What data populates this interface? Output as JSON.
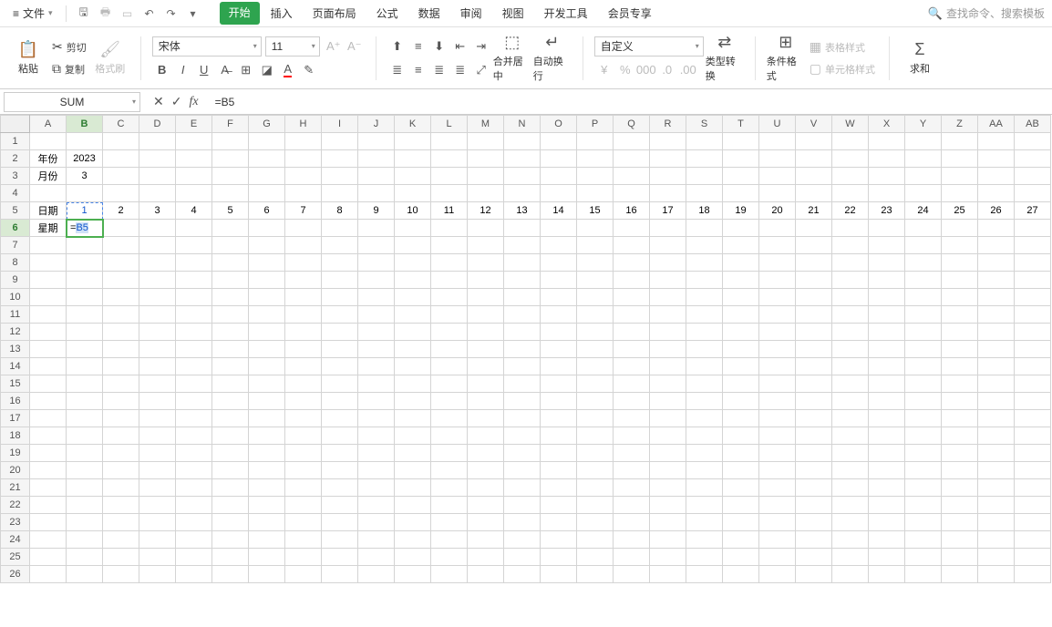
{
  "menubar": {
    "file_label": "文件",
    "tabs": [
      "开始",
      "插入",
      "页面布局",
      "公式",
      "数据",
      "审阅",
      "视图",
      "开发工具",
      "会员专享"
    ],
    "active_tab": 0,
    "search_placeholder": "查找命令、搜索模板"
  },
  "ribbon": {
    "paste": "粘贴",
    "cut": "剪切",
    "copy": "复制",
    "format_painter": "格式刷",
    "font_name": "宋体",
    "font_size": "11",
    "merge": "合并居中",
    "wrap": "自动换行",
    "number_format": "自定义",
    "type_convert": "类型转换",
    "cond_format": "条件格式",
    "table_style": "表格样式",
    "cell_style": "单元格样式",
    "sum": "求和"
  },
  "formula_bar": {
    "name_box": "SUM",
    "formula": "=B5"
  },
  "grid": {
    "columns": [
      "A",
      "B",
      "C",
      "D",
      "E",
      "F",
      "G",
      "H",
      "I",
      "J",
      "K",
      "L",
      "M",
      "N",
      "O",
      "P",
      "Q",
      "R",
      "S",
      "T",
      "U",
      "V",
      "W",
      "X",
      "Y",
      "Z",
      "AA",
      "AB"
    ],
    "col_widths": {
      "default": 40,
      "A": 40,
      "B": 40
    },
    "active_col": "B",
    "active_row": 6,
    "ref_cell": "B5",
    "edit_cell": "B6",
    "edit_text_eq": "=",
    "edit_text_ref": "B5",
    "row_count": 26,
    "cells": {
      "A2": "年份",
      "B2": "2023",
      "A3": "月份",
      "B3": "3",
      "A5": "日期",
      "B5": "1",
      "C5": "2",
      "D5": "3",
      "E5": "4",
      "F5": "5",
      "G5": "6",
      "H5": "7",
      "I5": "8",
      "J5": "9",
      "K5": "10",
      "L5": "11",
      "M5": "12",
      "N5": "13",
      "O5": "14",
      "P5": "15",
      "Q5": "16",
      "R5": "17",
      "S5": "18",
      "T5": "19",
      "U5": "20",
      "V5": "21",
      "W5": "22",
      "X5": "23",
      "Y5": "24",
      "Z5": "25",
      "AA5": "26",
      "AB5": "27",
      "A6": "星期"
    }
  }
}
